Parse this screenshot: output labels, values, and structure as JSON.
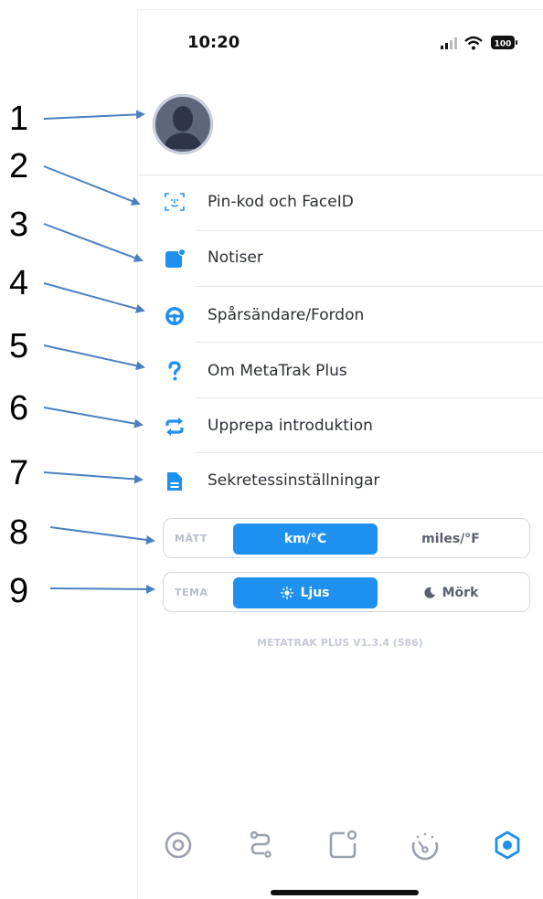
{
  "status_bar": {
    "time": "10:20",
    "battery": "100"
  },
  "menu": [
    {
      "label": "Pin-kod och FaceID",
      "icon": "face-id-icon"
    },
    {
      "label": "Notiser",
      "icon": "notification-icon"
    },
    {
      "label": "Spårsändare/Fordon",
      "icon": "steering-wheel-icon"
    },
    {
      "label": "Om MetaTrak Plus",
      "icon": "question-icon"
    },
    {
      "label": "Upprepa introduktion",
      "icon": "repeat-icon"
    },
    {
      "label": "Sekretessinställningar",
      "icon": "document-icon"
    }
  ],
  "units_toggle": {
    "caption": "MÄTT",
    "option_a": "km/°C",
    "option_b": "miles/°F",
    "selected": "option_a"
  },
  "theme_toggle": {
    "caption": "TEMA",
    "option_a": "Ljus",
    "option_b": "Mörk",
    "selected": "option_a"
  },
  "version_text": "METATRAK PLUS V1.3.4 (586)",
  "annotations": [
    "1",
    "2",
    "3",
    "4",
    "5",
    "6",
    "7",
    "8",
    "9"
  ],
  "tab_bar": [
    "target-icon",
    "route-icon",
    "notification-square-icon",
    "speedometer-icon",
    "settings-hexagon-icon"
  ],
  "colors": {
    "accent": "#1e90f0",
    "annotation_arrow": "#4a80c0"
  }
}
